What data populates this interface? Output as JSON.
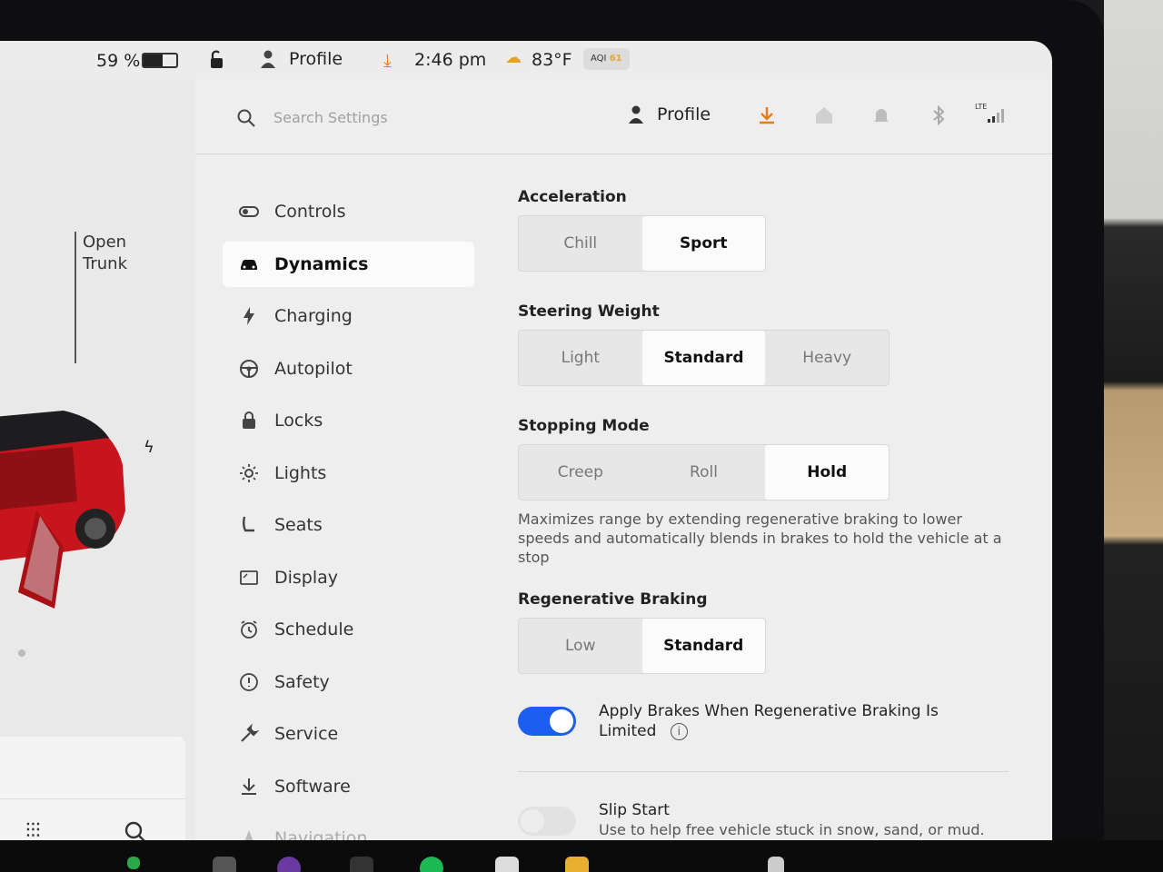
{
  "status_bar": {
    "battery_percent": "59 %",
    "battery_level": 0.59,
    "profile": "Profile",
    "time": "2:46 pm",
    "temperature": "83°F",
    "aqi_label": "AQI",
    "aqi_value": "61"
  },
  "car_panel": {
    "trunk_label_line1": "Open",
    "trunk_label_line2": "Trunk"
  },
  "header": {
    "search_placeholder": "Search Settings",
    "profile": "Profile",
    "signal_label": "LTE"
  },
  "nav": {
    "items": [
      {
        "label": "Controls",
        "icon": "toggle-icon"
      },
      {
        "label": "Dynamics",
        "icon": "car-icon",
        "active": true
      },
      {
        "label": "Charging",
        "icon": "bolt-icon"
      },
      {
        "label": "Autopilot",
        "icon": "steering-wheel-icon"
      },
      {
        "label": "Locks",
        "icon": "lock-icon"
      },
      {
        "label": "Lights",
        "icon": "sun-icon"
      },
      {
        "label": "Seats",
        "icon": "seat-icon"
      },
      {
        "label": "Display",
        "icon": "display-icon"
      },
      {
        "label": "Schedule",
        "icon": "clock-icon"
      },
      {
        "label": "Safety",
        "icon": "alert-icon"
      },
      {
        "label": "Service",
        "icon": "wrench-icon"
      },
      {
        "label": "Software",
        "icon": "download-icon"
      },
      {
        "label": "Navigation",
        "icon": "navigation-icon"
      }
    ]
  },
  "dynamics": {
    "acceleration": {
      "label": "Acceleration",
      "options": [
        "Chill",
        "Sport"
      ],
      "selected": "Sport"
    },
    "steering_weight": {
      "label": "Steering Weight",
      "options": [
        "Light",
        "Standard",
        "Heavy"
      ],
      "selected": "Standard"
    },
    "stopping_mode": {
      "label": "Stopping Mode",
      "options": [
        "Creep",
        "Roll",
        "Hold"
      ],
      "selected": "Hold",
      "description": "Maximizes range by extending regenerative braking to lower speeds and automatically blends in brakes to hold the vehicle at a stop"
    },
    "regen_braking": {
      "label": "Regenerative Braking",
      "options": [
        "Low",
        "Standard"
      ],
      "selected": "Standard"
    },
    "apply_brakes": {
      "label": "Apply Brakes When Regenerative Braking Is Limited",
      "enabled": true
    },
    "slip_start": {
      "label": "Slip Start",
      "description": "Use to help free vehicle stuck in snow, sand, or mud.",
      "enabled": false
    }
  },
  "colors": {
    "accent": "#1c5ff0",
    "download": "#e87a1e",
    "car_red": "#c8141c"
  }
}
